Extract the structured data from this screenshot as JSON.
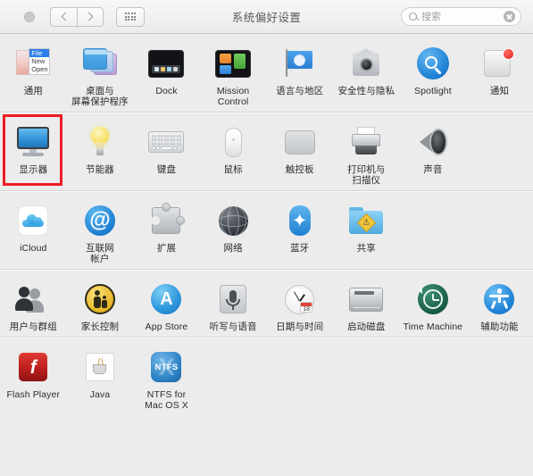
{
  "window": {
    "title": "系统偏好设置"
  },
  "toolbar": {
    "back_icon": "chevron-left-icon",
    "forward_icon": "chevron-right-icon",
    "grid_icon": "grid-view-icon",
    "search": {
      "placeholder": "搜索",
      "value": "",
      "icon": "search-icon",
      "clear_icon": "clear-icon"
    }
  },
  "rows": [
    {
      "id": "personal",
      "panes": [
        {
          "id": "general",
          "label": "通用",
          "icon": "general-icon",
          "highlighted": false
        },
        {
          "id": "desktop",
          "label": "桌面与\n屏幕保护程序",
          "icon": "desktop-screensaver-icon",
          "highlighted": false
        },
        {
          "id": "dock",
          "label": "Dock",
          "icon": "dock-icon",
          "highlighted": false
        },
        {
          "id": "mission",
          "label": "Mission\nControl",
          "icon": "mission-control-icon",
          "highlighted": false
        },
        {
          "id": "language",
          "label": "语言与地区",
          "icon": "language-region-icon",
          "highlighted": false
        },
        {
          "id": "security",
          "label": "安全性与隐私",
          "icon": "security-privacy-icon",
          "highlighted": false
        },
        {
          "id": "spotlight",
          "label": "Spotlight",
          "icon": "spotlight-icon",
          "highlighted": false
        },
        {
          "id": "notifications",
          "label": "通知",
          "icon": "notifications-icon",
          "highlighted": false
        }
      ]
    },
    {
      "id": "hardware",
      "panes": [
        {
          "id": "displays",
          "label": "显示器",
          "icon": "displays-icon",
          "highlighted": true
        },
        {
          "id": "energy",
          "label": "节能器",
          "icon": "energy-saver-icon",
          "highlighted": false
        },
        {
          "id": "keyboard",
          "label": "键盘",
          "icon": "keyboard-icon",
          "highlighted": false
        },
        {
          "id": "mouse",
          "label": "鼠标",
          "icon": "mouse-icon",
          "highlighted": false
        },
        {
          "id": "trackpad",
          "label": "触控板",
          "icon": "trackpad-icon",
          "highlighted": false
        },
        {
          "id": "printers",
          "label": "打印机与\n扫描仪",
          "icon": "printers-scanners-icon",
          "highlighted": false
        },
        {
          "id": "sound",
          "label": "声音",
          "icon": "sound-icon",
          "highlighted": false
        }
      ]
    },
    {
      "id": "internet",
      "panes": [
        {
          "id": "icloud",
          "label": "iCloud",
          "icon": "icloud-icon",
          "highlighted": false
        },
        {
          "id": "accounts",
          "label": "互联网\n帐户",
          "icon": "internet-accounts-icon",
          "highlighted": false
        },
        {
          "id": "extensions",
          "label": "扩展",
          "icon": "extensions-icon",
          "highlighted": false
        },
        {
          "id": "network",
          "label": "网络",
          "icon": "network-icon",
          "highlighted": false
        },
        {
          "id": "bluetooth",
          "label": "蓝牙",
          "icon": "bluetooth-icon",
          "highlighted": false
        },
        {
          "id": "sharing",
          "label": "共享",
          "icon": "sharing-icon",
          "highlighted": false
        }
      ]
    },
    {
      "id": "system",
      "panes": [
        {
          "id": "users",
          "label": "用户与群组",
          "icon": "users-groups-icon",
          "highlighted": false
        },
        {
          "id": "parental",
          "label": "家长控制",
          "icon": "parental-controls-icon",
          "highlighted": false
        },
        {
          "id": "appstore",
          "label": "App Store",
          "icon": "app-store-icon",
          "highlighted": false
        },
        {
          "id": "dictation",
          "label": "听写与语音",
          "icon": "dictation-speech-icon",
          "highlighted": false
        },
        {
          "id": "datetime",
          "label": "日期与时间",
          "icon": "date-time-icon",
          "highlighted": false
        },
        {
          "id": "startupdisk",
          "label": "启动磁盘",
          "icon": "startup-disk-icon",
          "highlighted": false
        },
        {
          "id": "timemachine",
          "label": "Time Machine",
          "icon": "time-machine-icon",
          "highlighted": false
        },
        {
          "id": "accessibility",
          "label": "辅助功能",
          "icon": "accessibility-icon",
          "highlighted": false
        }
      ]
    },
    {
      "id": "other",
      "panes": [
        {
          "id": "flash",
          "label": "Flash Player",
          "icon": "flash-player-icon",
          "highlighted": false
        },
        {
          "id": "java",
          "label": "Java",
          "icon": "java-icon",
          "highlighted": false
        },
        {
          "id": "ntfs",
          "label": "NTFS for\nMac OS X",
          "icon": "ntfs-icon",
          "highlighted": false
        }
      ]
    }
  ],
  "icon_glyphs": {
    "general_menu_items": [
      "File",
      "New",
      "Open"
    ],
    "at_symbol": "@",
    "bluetooth_symbol": "✦",
    "appstore_symbol": "A",
    "sharing_symbol": "⚠",
    "flash_symbol": "f",
    "ntfs_x": "X",
    "ntfs_text": "NTFS",
    "clock_date": "18"
  },
  "colors": {
    "highlight_box": "#ec1c24",
    "window_background": "#ececec",
    "toolbar_background": "#f2f2f2",
    "divider": "#d5d5d5",
    "label_text": "#2b2b2b",
    "title_text": "#5a5a5a"
  }
}
